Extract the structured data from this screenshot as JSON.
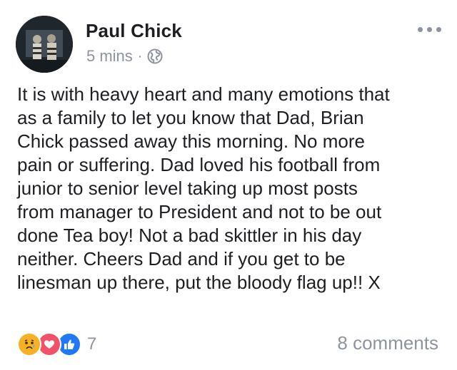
{
  "post": {
    "author": "Paul Chick",
    "time": "5 mins",
    "separator": "·",
    "privacy_icon": "globe-icon",
    "more_icon": "more-dots-icon",
    "text": "It is with heavy heart and many emotions that\nas a family to let you know  that Dad, Brian\nChick passed away this morning. No more\npain or suffering. Dad loved his football from\njunior  to senior level taking up most posts\nfrom manager to President and not to be out\ndone Tea boy!  Not a bad skittler  in his day\nneither. Cheers Dad and if you get to be\nlinesman up there, put the bloody flag up!!  X"
  },
  "footer": {
    "reactions": [
      "sad-reaction-icon",
      "love-reaction-icon",
      "like-reaction-icon"
    ],
    "reaction_count": "7",
    "comments": "8 comments"
  },
  "colors": {
    "sad": "#f7b125",
    "love": "#f25268",
    "like": "#2078f4",
    "secondary_text": "#8d949e"
  }
}
